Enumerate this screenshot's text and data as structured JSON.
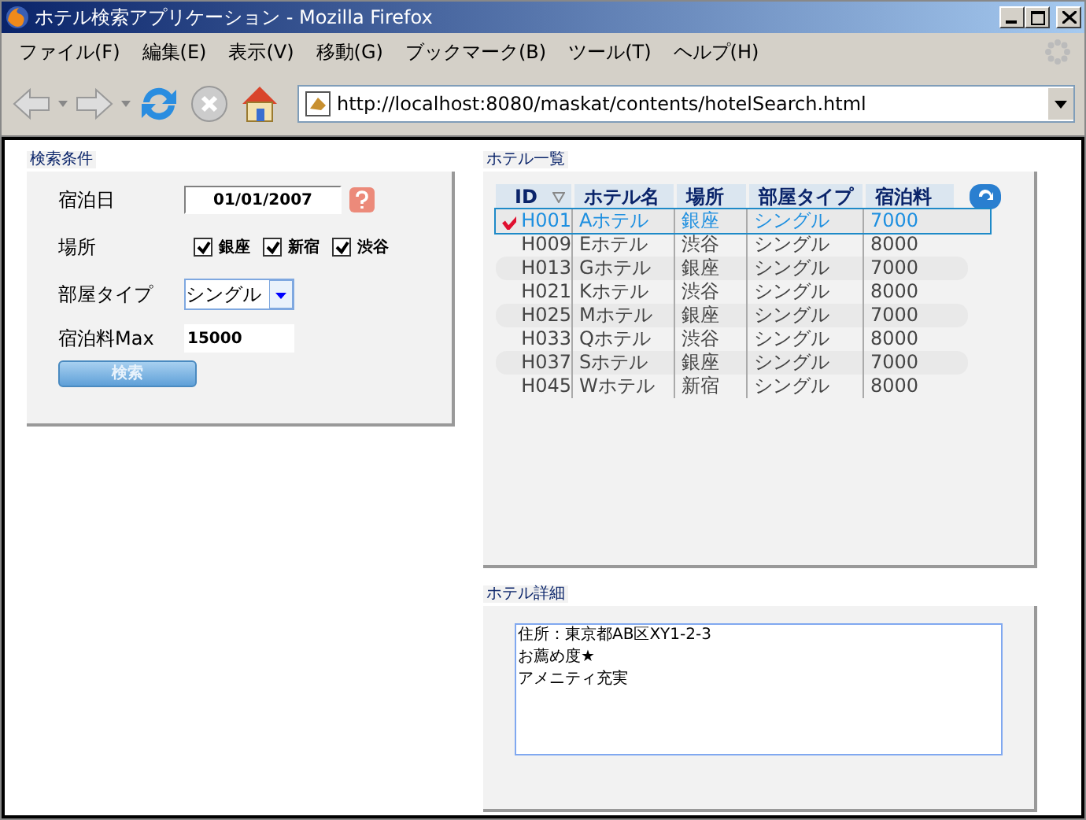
{
  "window": {
    "title": "ホテル検索アプリケーション - Mozilla Firefox"
  },
  "menu": [
    "ファイル(F)",
    "編集(E)",
    "表示(V)",
    "移動(G)",
    "ブックマーク(B)",
    "ツール(T)",
    "ヘルプ(H)"
  ],
  "address": {
    "url": "http://localhost:8080/maskat/contents/hotelSearch.html"
  },
  "search_panel": {
    "title": "検索条件",
    "date": {
      "label": "宿泊日",
      "value": "01/01/2007"
    },
    "location": {
      "label": "場所",
      "options": [
        {
          "label": "銀座",
          "checked": true
        },
        {
          "label": "新宿",
          "checked": true
        },
        {
          "label": "渋谷",
          "checked": true
        }
      ]
    },
    "room_type": {
      "label": "部屋タイプ",
      "value": "シングル"
    },
    "max_price": {
      "label": "宿泊料Max",
      "value": "15000"
    },
    "button": "検索"
  },
  "hotel_list": {
    "title": "ホテル一覧",
    "columns": [
      "ID",
      "ホテル名",
      "場所",
      "部屋タイプ",
      "宿泊料"
    ],
    "rows": [
      {
        "cells": [
          "H001",
          "Aホテル",
          "銀座",
          "シングル",
          "7000"
        ],
        "selected": true
      },
      {
        "cells": [
          "H009",
          "Eホテル",
          "渋谷",
          "シングル",
          "8000"
        ],
        "selected": false
      },
      {
        "cells": [
          "H013",
          "Gホテル",
          "銀座",
          "シングル",
          "7000"
        ],
        "selected": false
      },
      {
        "cells": [
          "H021",
          "Kホテル",
          "渋谷",
          "シングル",
          "8000"
        ],
        "selected": false
      },
      {
        "cells": [
          "H025",
          "Mホテル",
          "銀座",
          "シングル",
          "7000"
        ],
        "selected": false
      },
      {
        "cells": [
          "H033",
          "Qホテル",
          "渋谷",
          "シングル",
          "8000"
        ],
        "selected": false
      },
      {
        "cells": [
          "H037",
          "Sホテル",
          "銀座",
          "シングル",
          "7000"
        ],
        "selected": false
      },
      {
        "cells": [
          "H045",
          "Wホテル",
          "新宿",
          "シングル",
          "8000"
        ],
        "selected": false
      }
    ]
  },
  "detail": {
    "title": "ホテル詳細",
    "lines": [
      "住所：東京都AB区XY1-2-3",
      "お薦め度★",
      "アメニティ充実"
    ]
  }
}
